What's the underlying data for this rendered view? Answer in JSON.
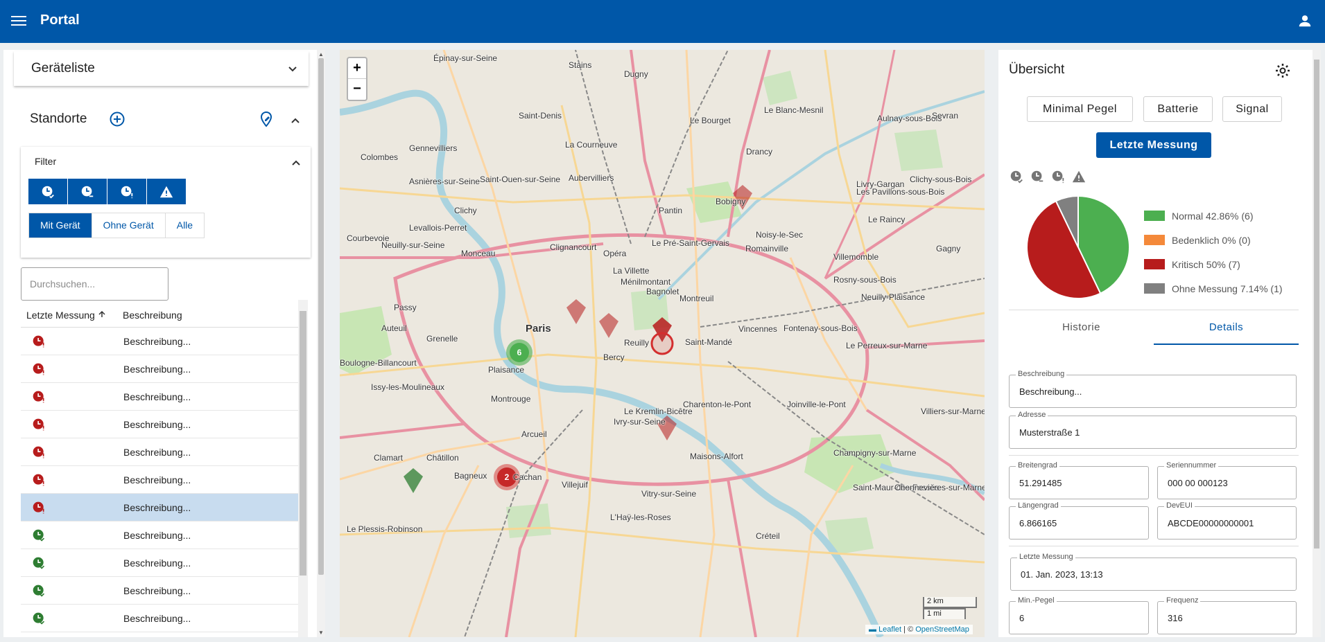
{
  "header": {
    "title": "Portal",
    "menu_icon": "menu-icon",
    "user_icon": "account-icon"
  },
  "left": {
    "device_list_title": "Geräteliste",
    "locations_title": "Standorte",
    "filter_title": "Filter",
    "filter_icons": [
      "clock-check-icon",
      "clock-minus-icon",
      "clock-alert-icon",
      "warning-icon"
    ],
    "segments": [
      "Mit Gerät",
      "Ohne Gerät",
      "Alle"
    ],
    "search_placeholder": "Durchsuchen...",
    "columns": [
      "Letzte Messung",
      "Beschreibung"
    ],
    "rows": [
      {
        "status": "critical",
        "desc": "Beschreibung..."
      },
      {
        "status": "critical",
        "desc": "Beschreibung..."
      },
      {
        "status": "critical",
        "desc": "Beschreibung..."
      },
      {
        "status": "critical",
        "desc": "Beschreibung..."
      },
      {
        "status": "critical",
        "desc": "Beschreibung..."
      },
      {
        "status": "critical",
        "desc": "Beschreibung..."
      },
      {
        "status": "critical",
        "desc": "Beschreibung...",
        "selected": true
      },
      {
        "status": "normal",
        "desc": "Beschreibung..."
      },
      {
        "status": "normal",
        "desc": "Beschreibung..."
      },
      {
        "status": "normal",
        "desc": "Beschreibung..."
      },
      {
        "status": "normal",
        "desc": "Beschreibung..."
      }
    ]
  },
  "map": {
    "zoom_in": "+",
    "zoom_out": "−",
    "scale_km": "2 km",
    "scale_mi": "1 mi",
    "attribution_leaflet": "Leaflet",
    "attribution_sep": " | © ",
    "attribution_osm": "OpenStreetMap",
    "clusters": [
      {
        "count": "6"
      },
      {
        "count": "2"
      }
    ],
    "labels": [
      "Épinay-sur-Seine",
      "Stains",
      "Dugny",
      "Saint-Denis",
      "Le Bourget",
      "Le Blanc-Mesnil",
      "Aulnay-sous-Bois",
      "Sevran",
      "Gennevilliers",
      "La Courneuve",
      "Drancy",
      "Colombes",
      "Aubervilliers",
      "Saint-Ouen-sur-Seine",
      "Asnières-sur-Seine",
      "Bobigny",
      "Livry-Gargan",
      "Clichy-sous-Bois",
      "Les Pavillons-sous-Bois",
      "Clichy",
      "Pantin",
      "Le Raincy",
      "Levallois-Perret",
      "Noisy-le-Sec",
      "Courbevoie",
      "Neuilly-sur-Seine",
      "Le Pré-Saint-Gervais",
      "Romainville",
      "Villemomble",
      "Gagny",
      "Bagnolet",
      "Montreuil",
      "Rosny-sous-Bois",
      "Neuilly-Plaisance",
      "Paris",
      "Vincennes",
      "Fontenay-sous-Bois",
      "Saint-Mandé",
      "Le Perreux-sur-Marne",
      "Boulogne-Billancourt",
      "Issy-les-Moulineaux",
      "Montrouge",
      "Charenton-le-Pont",
      "Joinville-le-Pont",
      "Villiers-sur-Marne",
      "Le Kremlin-Bicêtre",
      "Ivry-sur-Seine",
      "Arcueil",
      "Maisons-Alfort",
      "Champigny-sur-Marne",
      "Clamart",
      "Châtillon",
      "Bagneux",
      "Cachan",
      "Villejuif",
      "Saint-Maur-des-Fossés",
      "Vitry-sur-Seine",
      "Chennevières-sur-Marne",
      "Le Plessis-Robinson",
      "L'Haÿ-les-Roses",
      "Créteil",
      "Passy",
      "Grenelle",
      "Auteuil",
      "Plaisance",
      "Bercy",
      "Reuilly",
      "Ménilmontant",
      "La Villette",
      "Opéra",
      "Monceau",
      "Clignancourt"
    ]
  },
  "right": {
    "title": "Übersicht",
    "buttons": [
      "Minimal Pegel",
      "Batterie",
      "Signal"
    ],
    "active_button": "Letzte Messung",
    "stat_icons": [
      "clock-check-icon",
      "clock-minus-icon",
      "clock-alert-icon",
      "warning-icon"
    ],
    "legend": [
      {
        "label": "Normal 42.86% (6)",
        "color": "#4caf50",
        "value": 42.86
      },
      {
        "label": "Bedenklich 0% (0)",
        "color": "#f4893a",
        "value": 0
      },
      {
        "label": "Kritisch 50% (7)",
        "color": "#b71c1c",
        "value": 50
      },
      {
        "label": "Ohne Messung 7.14% (1)",
        "color": "#808080",
        "value": 7.14
      }
    ],
    "tabs": [
      "Historie",
      "Details"
    ],
    "fields": {
      "beschreibung": {
        "label": "Beschreibung",
        "value": "Beschreibung..."
      },
      "adresse": {
        "label": "Adresse",
        "value": "Musterstraße 1"
      },
      "breitengrad": {
        "label": "Breitengrad",
        "value": "51.291485"
      },
      "seriennummer": {
        "label": "Seriennummer",
        "value": "000 00 000123"
      },
      "laengengrad": {
        "label": "Längengrad",
        "value": "6.866165"
      },
      "deveui": {
        "label": "DevEUI",
        "value": "ABCDE00000000001"
      },
      "letzte": {
        "label": "Letzte Messung",
        "value": "01. Jan. 2023, 13:13"
      },
      "minpegel": {
        "label": "Min.-Pegel",
        "value": "6"
      },
      "frequenz": {
        "label": "Frequenz",
        "value": "316"
      }
    }
  }
}
